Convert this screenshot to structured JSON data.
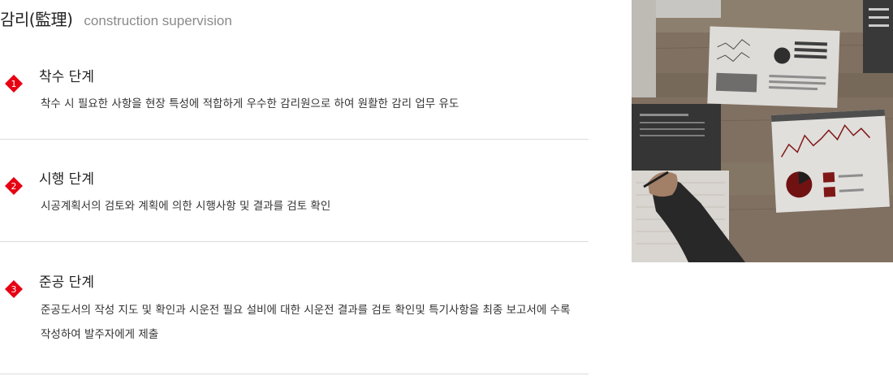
{
  "header": {
    "title": "감리(監理)",
    "subtitle": "construction supervision"
  },
  "steps": [
    {
      "number": "1",
      "title": "착수 단계",
      "description": "착수 시 필요한 사항을 현장 특성에 적합하게 우수한 감리원으로 하여 원활한 감리 업무 유도"
    },
    {
      "number": "2",
      "title": "시행 단계",
      "description": "시공계획서의 검토와 계획에 의한 시행사항 및 결과를 검토 확인"
    },
    {
      "number": "3",
      "title": "준공 단계",
      "description": "준공도서의 작성 지도 및 확인과 시운전 필요 설비에 대한 시운전 결과를 검토 확인및 특기사항을 최종 보고서에 수록 작성하여 발주자에게 제출"
    }
  ],
  "colors": {
    "accent": "#e60012",
    "divider": "#dcdcdc",
    "subtitle": "#8a8a8a"
  },
  "image": {
    "icon": "business-report-photo"
  }
}
